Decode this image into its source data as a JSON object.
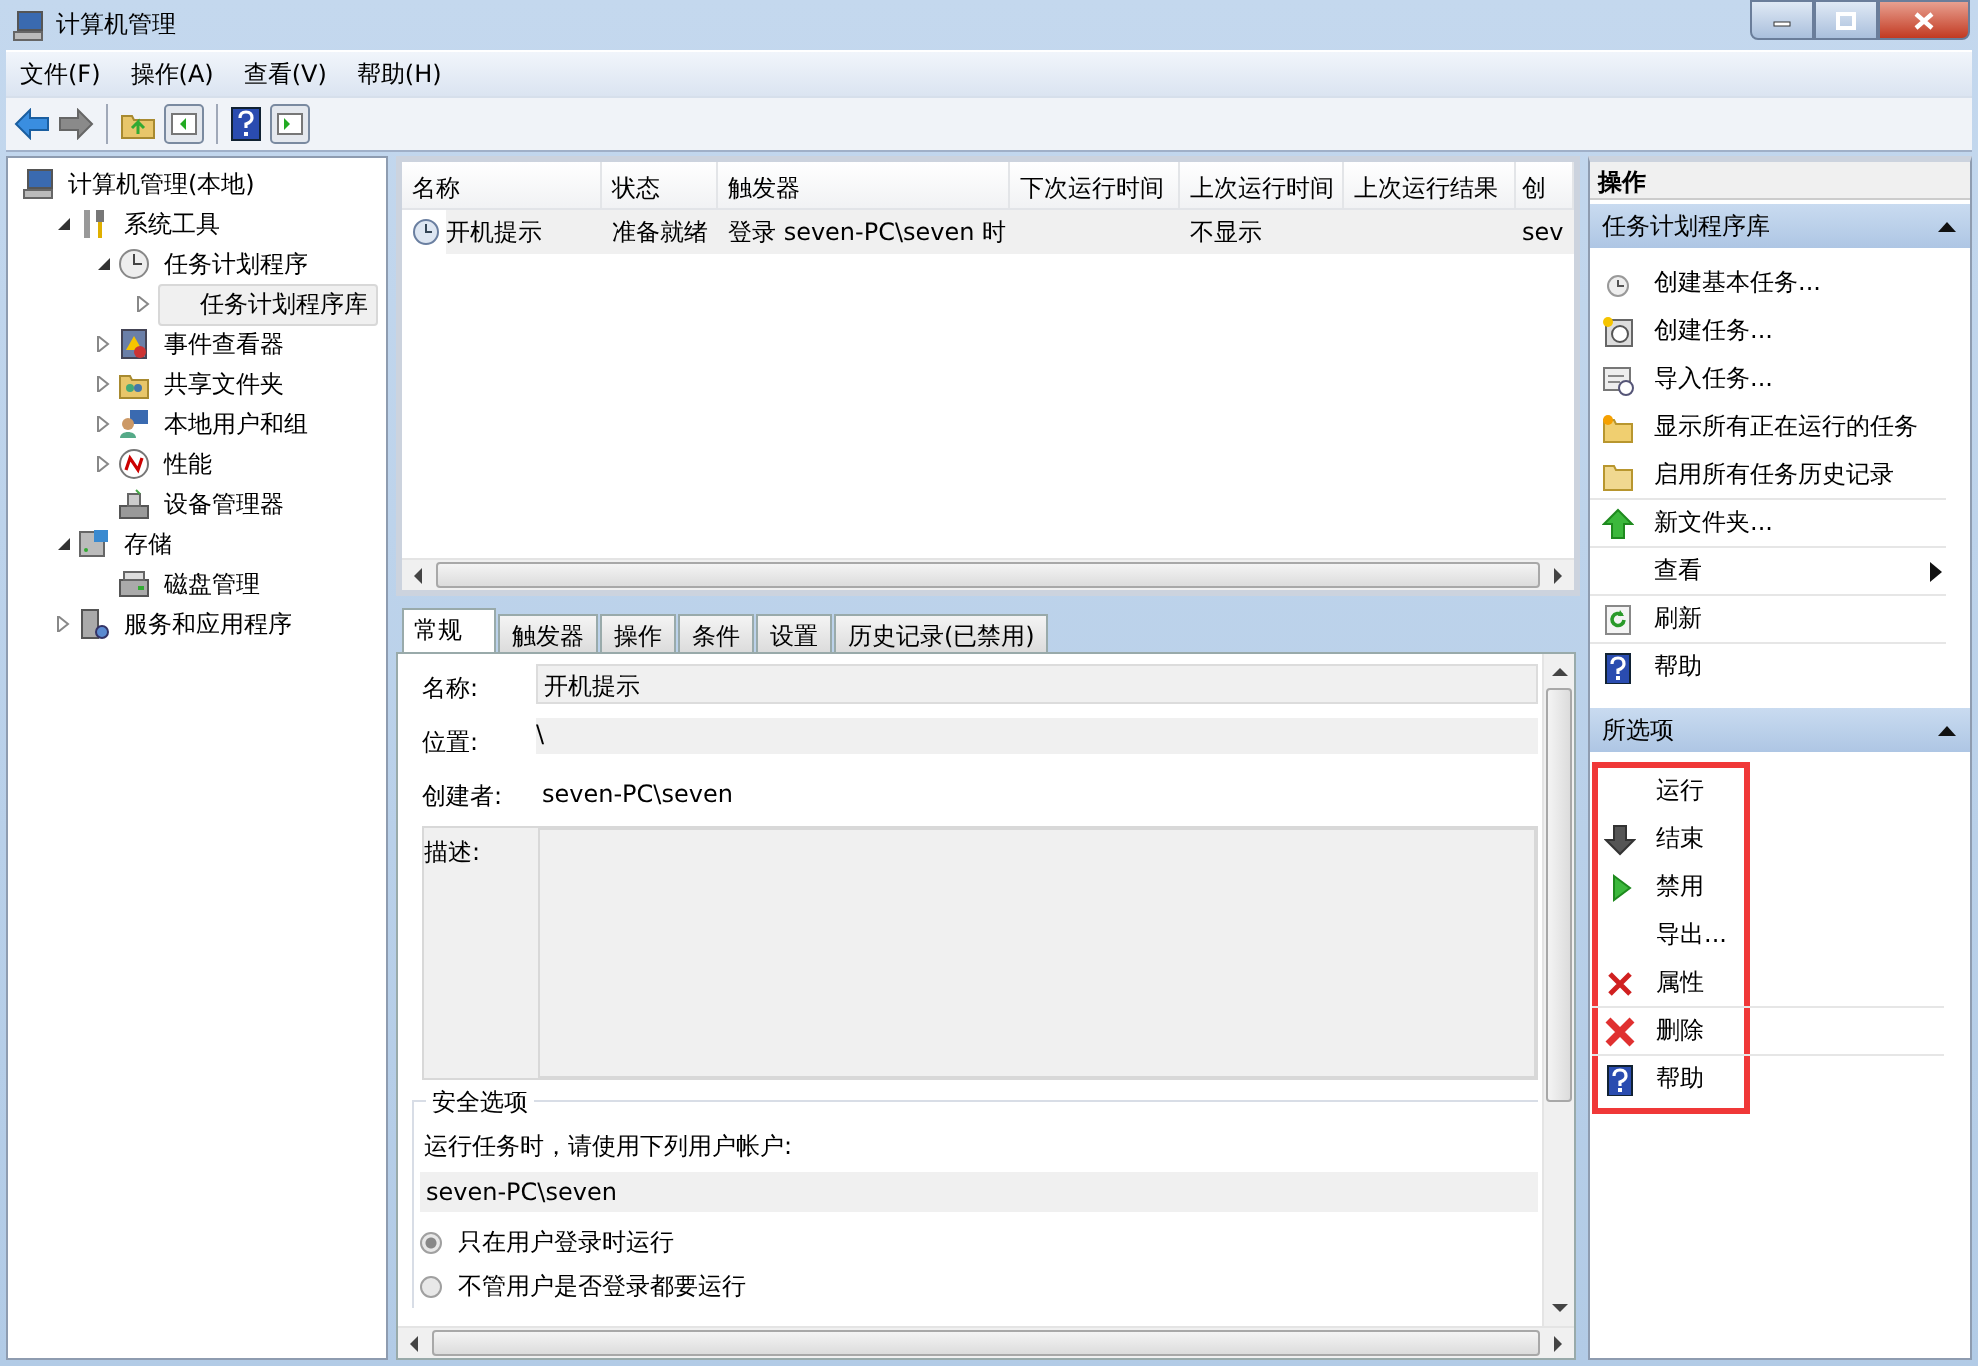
{
  "window": {
    "title": "计算机管理"
  },
  "menu": [
    {
      "label": "文件(F)"
    },
    {
      "label": "操作(A)"
    },
    {
      "label": "查看(V)"
    },
    {
      "label": "帮助(H)"
    }
  ],
  "tree": [
    {
      "label": "计算机管理(本地)",
      "selected": false,
      "children": [
        {
          "label": "系统工具",
          "selected": false,
          "expanded": true,
          "children": [
            {
              "label": "任务计划程序",
              "selected": false,
              "expanded": true,
              "children": [
                {
                  "label": "任务计划程序库",
                  "selected": true,
                  "expanded": false
                }
              ]
            },
            {
              "label": "事件查看器",
              "selected": false,
              "expanded": false
            },
            {
              "label": "共享文件夹",
              "selected": false,
              "expanded": false
            },
            {
              "label": "本地用户和组",
              "selected": false,
              "expanded": false
            },
            {
              "label": "性能",
              "selected": false,
              "expanded": false
            },
            {
              "label": "设备管理器",
              "selected": false
            }
          ]
        },
        {
          "label": "存储",
          "selected": false,
          "expanded": true,
          "children": [
            {
              "label": "磁盘管理",
              "selected": false
            }
          ]
        },
        {
          "label": "服务和应用程序",
          "selected": false,
          "expanded": false
        }
      ]
    }
  ],
  "task_table": {
    "columns": [
      "名称",
      "状态",
      "触发器",
      "下次运行时间",
      "上次运行时间",
      "上次运行结果",
      "创"
    ],
    "rows": [
      {
        "cells": [
          "开机提示",
          "准备就绪",
          "登录 seven-PC\\seven 时",
          null,
          "不显示",
          null,
          "sev"
        ],
        "selected": true
      }
    ]
  },
  "detail_tabs": [
    {
      "label": "常规",
      "selected": true
    },
    {
      "label": "触发器",
      "selected": false
    },
    {
      "label": "操作",
      "selected": false
    },
    {
      "label": "条件",
      "selected": false
    },
    {
      "label": "设置",
      "selected": false
    },
    {
      "label": "历史记录(已禁用)",
      "selected": false
    }
  ],
  "general": {
    "fields": [
      {
        "label": "名称:",
        "kind": "field",
        "value": "开机提示"
      },
      {
        "label": "位置:",
        "kind": "readonly",
        "value": "\\"
      },
      {
        "label": "创建者:",
        "kind": "text",
        "value": "seven-PC\\seven"
      },
      {
        "label": "描述:",
        "kind": "area"
      }
    ],
    "security": {
      "legend": "安全选项",
      "prompt": "运行任务时，请使用下列用户帐户:",
      "account": "seven-PC\\seven",
      "options": [
        {
          "label": "只在用户登录时运行",
          "selected": true
        },
        {
          "label": "不管用户是否登录都要运行",
          "selected": false
        }
      ]
    }
  },
  "actions": {
    "title": "操作",
    "sections": [
      {
        "title": "任务计划程序库",
        "expanded": true,
        "highlighted": false,
        "items": [
          {
            "label": "创建基本任务...",
            "separator_after": false
          },
          {
            "label": "创建任务...",
            "separator_after": false
          },
          {
            "label": "导入任务...",
            "separator_after": false
          },
          {
            "label": "显示所有正在运行的任务",
            "separator_after": false
          },
          {
            "label": "启用所有任务历史记录",
            "separator_after": true
          },
          {
            "label": "新文件夹...",
            "separator_after": true
          },
          {
            "label": "查看",
            "submenu": true,
            "separator_after": true
          },
          {
            "label": "刷新",
            "separator_after": true
          },
          {
            "label": "帮助",
            "separator_after": false
          }
        ]
      },
      {
        "title": "所选项",
        "expanded": true,
        "highlighted": true,
        "items": [
          {
            "label": "运行",
            "separator_after": false
          },
          {
            "label": "结束",
            "separator_after": false
          },
          {
            "label": "禁用",
            "separator_after": false
          },
          {
            "label": "导出...",
            "separator_after": false
          },
          {
            "label": "属性",
            "separator_after": true
          },
          {
            "label": "删除",
            "separator_after": true
          },
          {
            "label": "帮助",
            "separator_after": false
          }
        ]
      }
    ]
  }
}
